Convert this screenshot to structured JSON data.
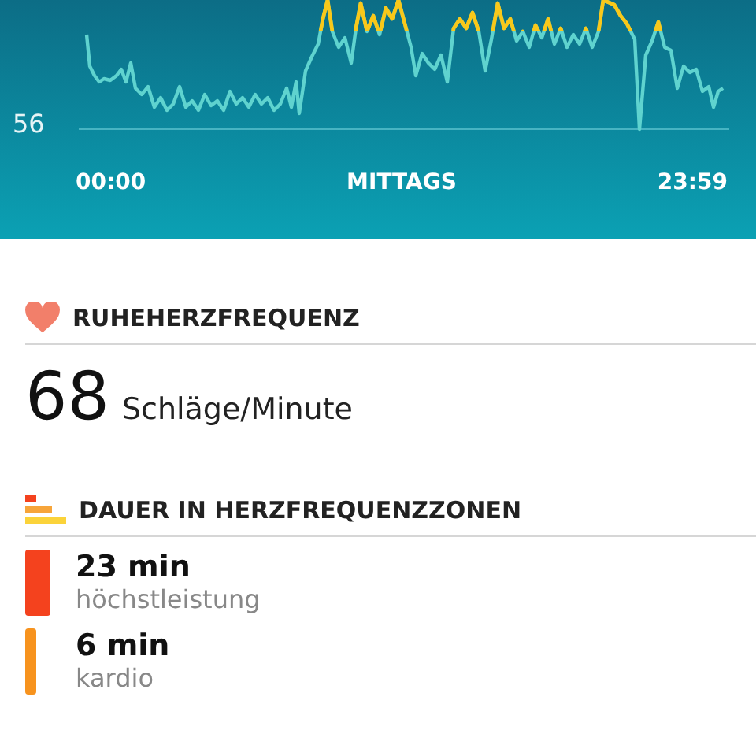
{
  "chart": {
    "y_label": "56",
    "x_labels": [
      "00:00",
      "MITTAGS",
      "23:59"
    ]
  },
  "resting": {
    "title": "RUHEHERZFREQUENZ",
    "value": "68",
    "unit": "Schläge/Minute"
  },
  "zones": {
    "title": "DAUER IN HERZFREQUENZZONEN",
    "items": [
      {
        "duration": "23 min",
        "name": "höchstleistung",
        "color": "#f4421e"
      },
      {
        "duration": "6 min",
        "name": "kardio",
        "color": "#f7931e"
      }
    ]
  }
}
